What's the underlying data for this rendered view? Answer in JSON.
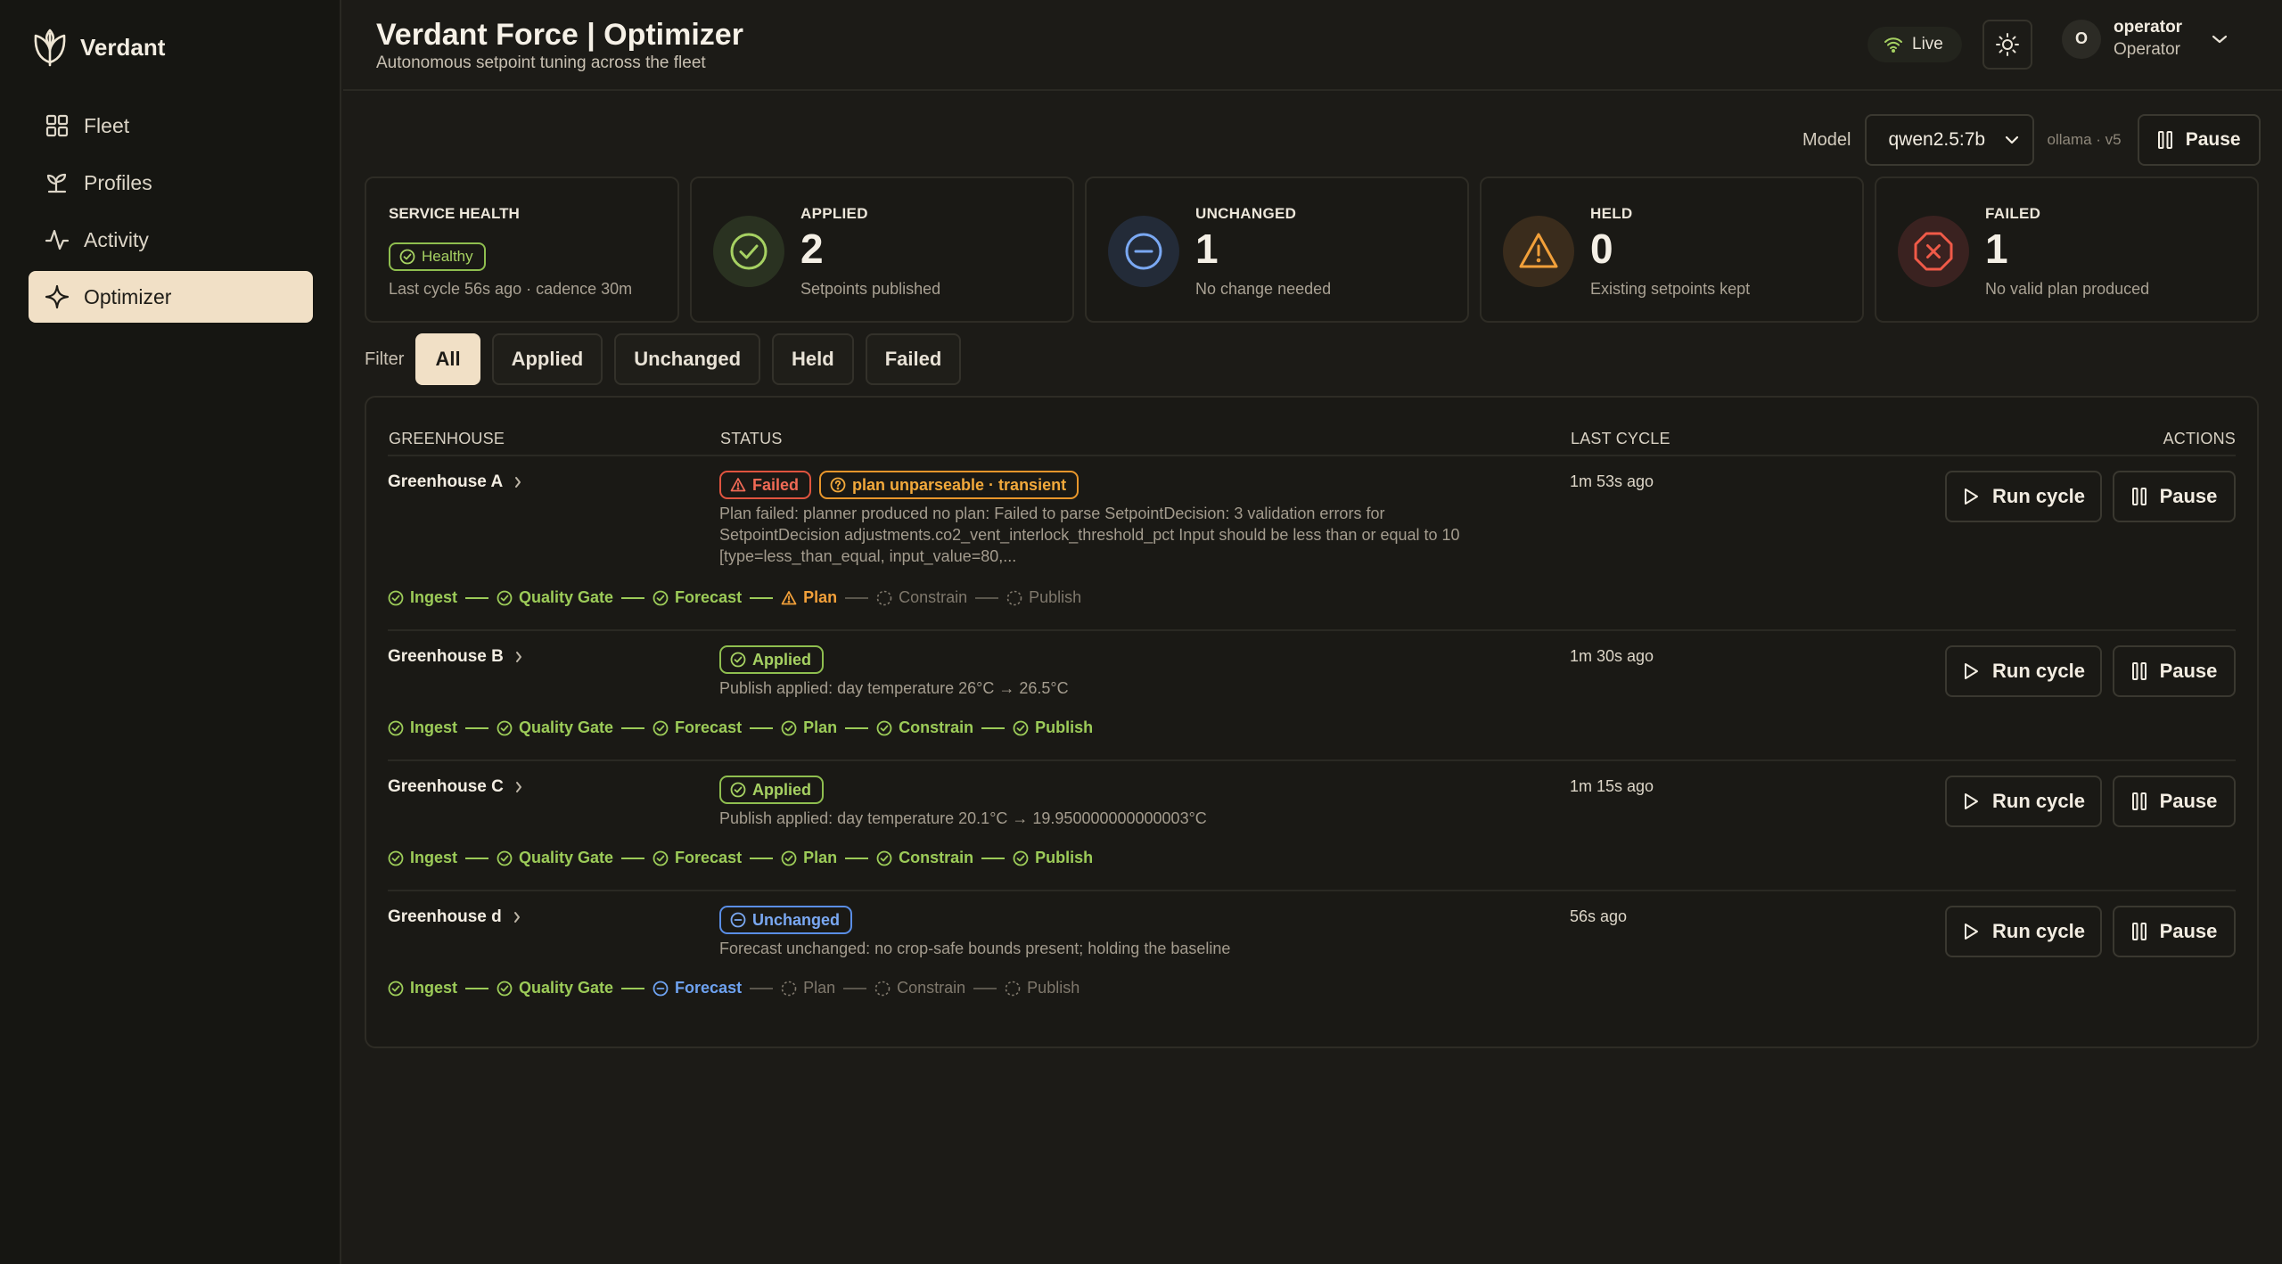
{
  "app": {
    "name": "Verdant"
  },
  "nav": [
    {
      "label": "Fleet",
      "icon": "grid-icon"
    },
    {
      "label": "Profiles",
      "icon": "sprout-icon"
    },
    {
      "label": "Activity",
      "icon": "activity-icon"
    },
    {
      "label": "Optimizer",
      "icon": "sparkle-icon",
      "active": true
    }
  ],
  "header": {
    "title": "Verdant Force | Optimizer",
    "subtitle": "Autonomous setpoint tuning across the fleet",
    "live_label": "Live",
    "user": {
      "initial": "O",
      "name": "operator",
      "role": "Operator"
    }
  },
  "model": {
    "label": "Model",
    "selected": "qwen2.5:7b",
    "meta": "ollama · v5",
    "pause_label": "Pause"
  },
  "stats": {
    "health": {
      "label": "SERVICE HEALTH",
      "badge": "Healthy",
      "sub": "Last cycle 56s ago · cadence 30m"
    },
    "applied": {
      "label": "APPLIED",
      "value": "2",
      "sub": "Setpoints published"
    },
    "unchanged": {
      "label": "UNCHANGED",
      "value": "1",
      "sub": "No change needed"
    },
    "held": {
      "label": "HELD",
      "value": "0",
      "sub": "Existing setpoints kept"
    },
    "failed": {
      "label": "FAILED",
      "value": "1",
      "sub": "No valid plan produced"
    }
  },
  "filter": {
    "label": "Filter",
    "options": [
      "All",
      "Applied",
      "Unchanged",
      "Held",
      "Failed"
    ],
    "selected": "All"
  },
  "table": {
    "headers": {
      "greenhouse": "GREENHOUSE",
      "status": "STATUS",
      "last_cycle": "LAST CYCLE",
      "actions": "ACTIONS"
    },
    "run_label": "Run cycle",
    "pause_label": "Pause",
    "stage_names": [
      "Ingest",
      "Quality Gate",
      "Forecast",
      "Plan",
      "Constrain",
      "Publish"
    ],
    "rows": [
      {
        "name": "Greenhouse A",
        "status": "Failed",
        "extra_badge": "plan unparseable · transient",
        "message": "Plan failed: planner produced no plan: Failed to parse SetpointDecision: 3 validation errors for SetpointDecision adjustments.co2_vent_interlock_threshold_pct Input should be less than or equal to 10 [type=less_than_equal, input_value=80,...",
        "last_cycle": "1m 53s ago",
        "stages": [
          "ok",
          "ok",
          "ok",
          "warn",
          "pending",
          "pending"
        ]
      },
      {
        "name": "Greenhouse B",
        "status": "Applied",
        "message": "Publish applied: day temperature 26°C → 26.5°C",
        "last_cycle": "1m 30s ago",
        "stages": [
          "ok",
          "ok",
          "ok",
          "ok",
          "ok",
          "ok"
        ]
      },
      {
        "name": "Greenhouse C",
        "status": "Applied",
        "message": "Publish applied: day temperature 20.1°C → 19.950000000000003°C",
        "last_cycle": "1m 15s ago",
        "stages": [
          "ok",
          "ok",
          "ok",
          "ok",
          "ok",
          "ok"
        ]
      },
      {
        "name": "Greenhouse d",
        "status": "Unchanged",
        "message": "Forecast unchanged: no crop-safe bounds present; holding the baseline",
        "last_cycle": "56s ago",
        "stages": [
          "ok",
          "ok",
          "info",
          "pending",
          "pending",
          "pending"
        ]
      }
    ]
  },
  "colors": {
    "background": "#1c1b17",
    "accent": "#f1e0c6",
    "ok": "#9ccb58",
    "warn": "#f2a03a",
    "error": "#f06a55",
    "info": "#6ea2f0"
  }
}
